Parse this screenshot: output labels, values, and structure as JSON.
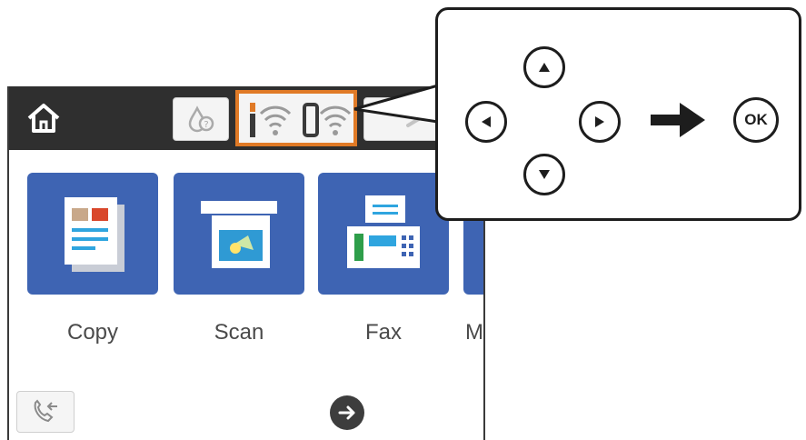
{
  "screen": {
    "topbar": {
      "icons": [
        "home-icon",
        "ink-drop-help-icon",
        "wifi-signal-icon",
        "wifi-direct-icon",
        "wrench-icon"
      ]
    },
    "tiles": [
      {
        "label": "Copy",
        "icon": "copy-icon"
      },
      {
        "label": "Scan",
        "icon": "scan-icon"
      },
      {
        "label": "Fax",
        "icon": "fax-icon"
      },
      {
        "label": "M",
        "icon": "more-icon"
      }
    ],
    "bottom": {
      "icons": [
        "fax-redial-icon",
        "arrow-right-circle-icon"
      ]
    },
    "colors": {
      "tile": "#3e64b3",
      "highlight": "#e07a26",
      "topbar": "#2f2f2f"
    }
  },
  "callout": {
    "buttons": [
      "up-arrow-icon",
      "left-arrow-icon",
      "right-arrow-icon",
      "down-arrow-icon"
    ],
    "ok_label": "OK"
  }
}
